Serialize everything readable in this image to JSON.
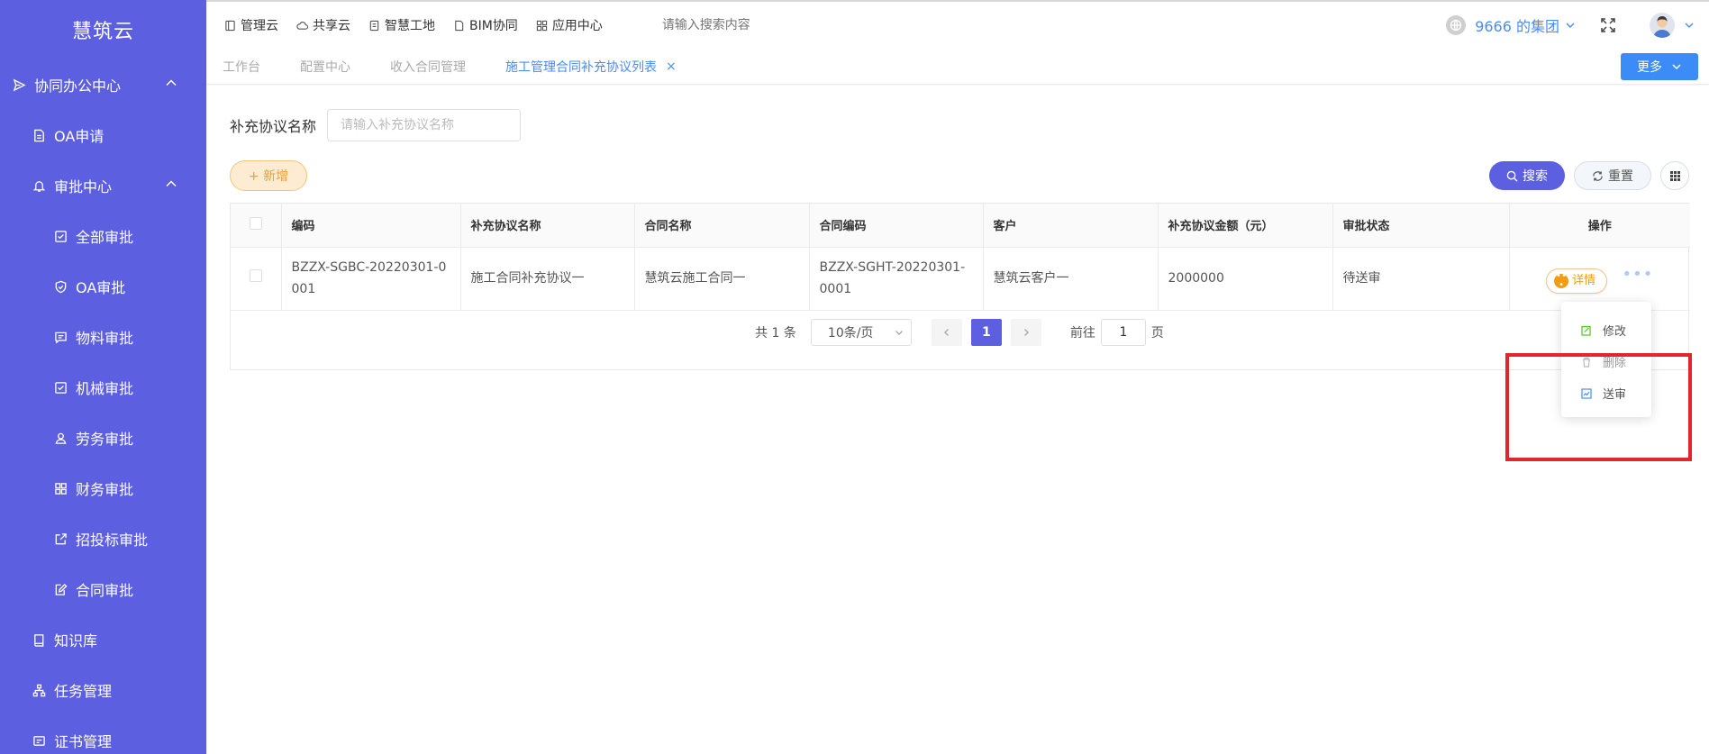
{
  "app_name": "慧筑云",
  "sidebar": {
    "items": [
      {
        "label": "协同办公中心",
        "icon": "send-icon",
        "level": 0,
        "expanded": true
      },
      {
        "label": "OA申请",
        "icon": "document-icon",
        "level": 1
      },
      {
        "label": "审批中心",
        "icon": "bell-icon",
        "level": 1,
        "expanded": true
      },
      {
        "label": "全部审批",
        "icon": "checkbox-icon",
        "level": 2
      },
      {
        "label": "OA审批",
        "icon": "shield-check-icon",
        "level": 2
      },
      {
        "label": "物料审批",
        "icon": "message-icon",
        "level": 2
      },
      {
        "label": "机械审批",
        "icon": "checkbox-icon",
        "level": 2
      },
      {
        "label": "劳务审批",
        "icon": "user-icon",
        "level": 2
      },
      {
        "label": "财务审批",
        "icon": "grid-icon",
        "level": 2
      },
      {
        "label": "招投标审批",
        "icon": "external-link-icon",
        "level": 2
      },
      {
        "label": "合同审批",
        "icon": "edit-doc-icon",
        "level": 2
      },
      {
        "label": "知识库",
        "icon": "book-icon",
        "level": 1
      },
      {
        "label": "任务管理",
        "icon": "org-chart-icon",
        "level": 1
      },
      {
        "label": "证书管理",
        "icon": "certificate-icon",
        "level": 1
      }
    ]
  },
  "topbar": {
    "links": [
      {
        "label": "管理云",
        "icon": "panel-icon"
      },
      {
        "label": "共享云",
        "icon": "cloud-icon"
      },
      {
        "label": "智慧工地",
        "icon": "clipboard-icon"
      },
      {
        "label": "BIM协同",
        "icon": "doc-icon"
      },
      {
        "label": "应用中心",
        "icon": "apps-icon"
      }
    ],
    "search_placeholder": "请输入搜索内容",
    "org_name": "9666 的集团"
  },
  "tabs": [
    {
      "label": "工作台",
      "active": false
    },
    {
      "label": "配置中心",
      "active": false
    },
    {
      "label": "收入合同管理",
      "active": false
    },
    {
      "label": "施工管理合同补充协议列表",
      "active": true,
      "closable": true
    }
  ],
  "tab_close": "×",
  "more_label": "更多",
  "filter": {
    "label": "补充协议名称",
    "placeholder": "请输入补充协议名称"
  },
  "buttons": {
    "add": "+ 新增",
    "search": "搜索",
    "reset": "重置"
  },
  "table": {
    "headers": [
      "编码",
      "补充协议名称",
      "合同名称",
      "合同编码",
      "客户",
      "补充协议金额（元）",
      "审批状态",
      "操作"
    ],
    "rows": [
      {
        "code": "BZZX-SGBC-20220301-0001",
        "agreement_name": "施工合同补充协议一",
        "contract_name": "慧筑云施工合同一",
        "contract_code": "BZZX-SGHT-20220301-0001",
        "customer": "慧筑云客户一",
        "amount": "2000000",
        "status": "待送审",
        "detail_label": "详情"
      }
    ]
  },
  "pagination": {
    "total_text": "共 1 条",
    "page_size": "10条/页",
    "current_page": "1",
    "goto_prefix": "前往",
    "goto_value": "1",
    "goto_suffix": "页"
  },
  "row_menu": {
    "items": [
      {
        "label": "修改",
        "icon": "edit-icon",
        "color": "#52c41a"
      },
      {
        "label": "删除",
        "icon": "delete-icon",
        "color": "#999999"
      },
      {
        "label": "送审",
        "icon": "submit-icon",
        "color": "#4a8cf7"
      }
    ]
  },
  "colors": {
    "sidebar": "#5b5fe0",
    "primary": "#5b5fe0",
    "accent_blue": "#4a8cf7",
    "highlight": "#e3262e"
  }
}
